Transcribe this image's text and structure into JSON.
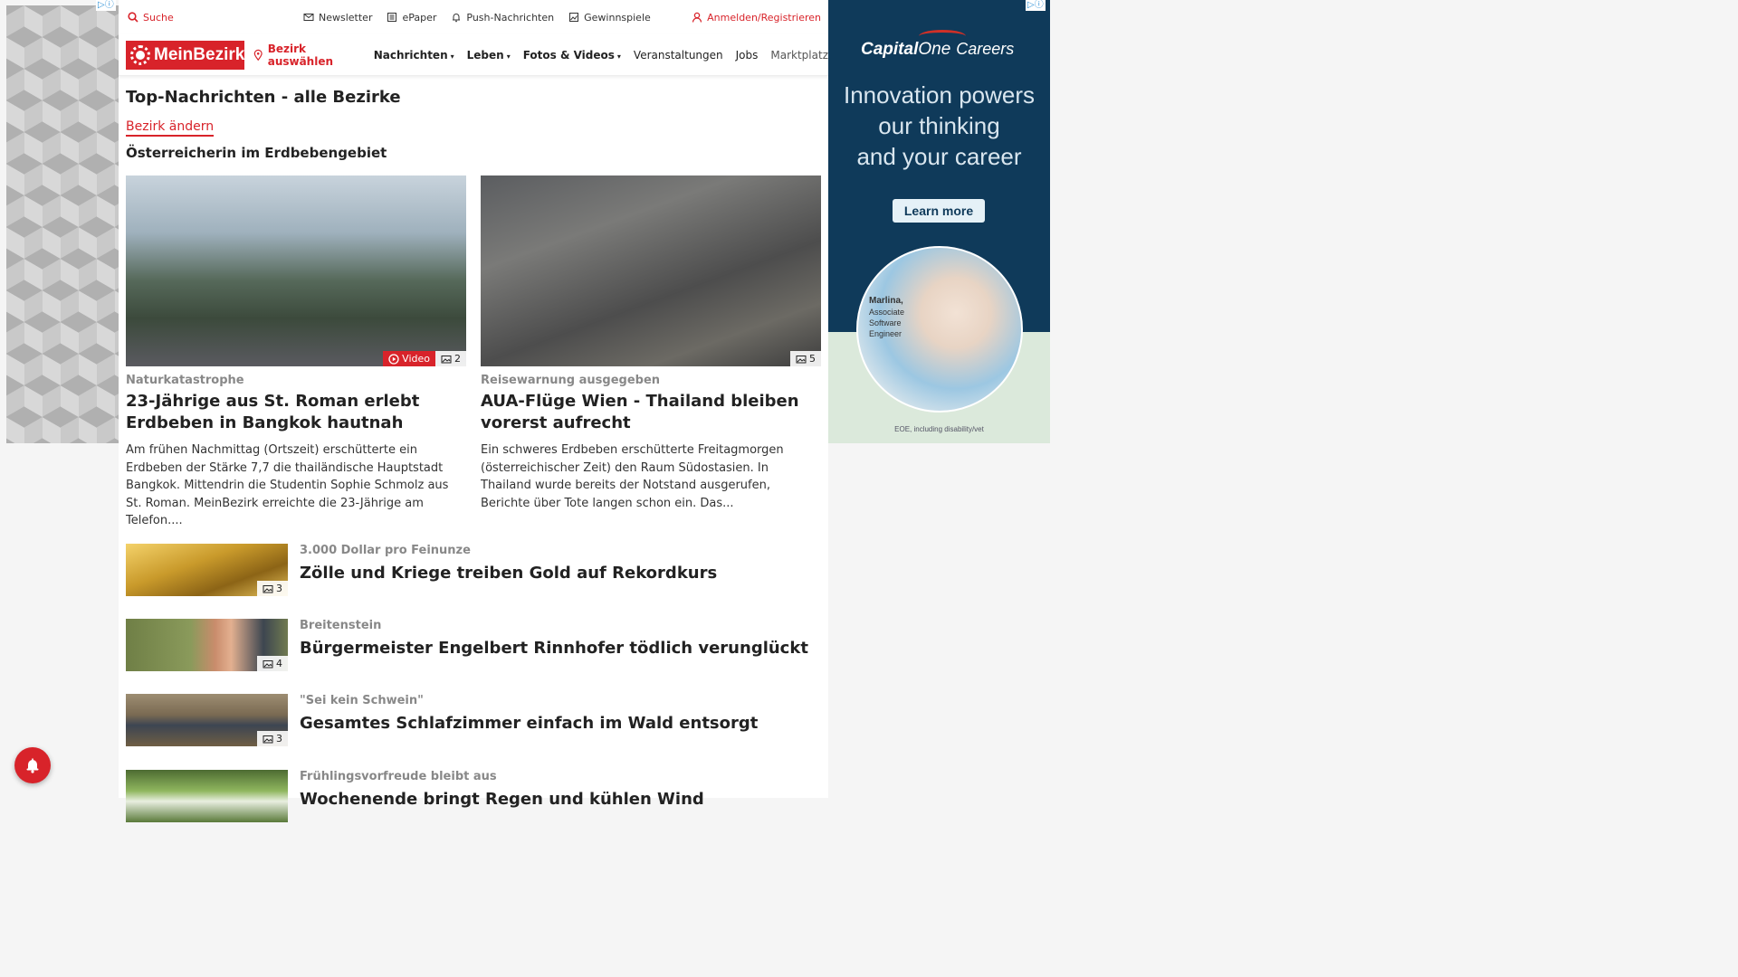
{
  "left_ad": {
    "badge": "▷ⓘ"
  },
  "topbar": {
    "search": "Suche",
    "links": [
      "Newsletter",
      "ePaper",
      "Push-Nachrichten",
      "Gewinnspiele"
    ],
    "login": "Anmelden/Registrieren"
  },
  "navbar": {
    "logo": "MeinBezirk",
    "bezirk": "Bezirk auswählen",
    "items": [
      "Nachrichten",
      "Leben",
      "Fotos & Videos",
      "Veranstaltungen",
      "Jobs",
      "Marktplatz"
    ]
  },
  "page": {
    "title": "Top-Nachrichten - alle Bezirke",
    "change_link": "Bezirk ändern",
    "section_title": "Österreicherin im Erdbebengebiet"
  },
  "cards": [
    {
      "kicker": "Naturkatastrophe",
      "headline": "23-Jährige aus St. Roman erlebt Erdbeben in Bangkok hautnah",
      "teaser": "Am frühen Nachmittag (Ortszeit) erschütterte ein Erdbeben der Stärke 7,7 die thailändische Hauptstadt Bangkok. Mittendrin die Studentin Sophie Schmolz aus St. Roman. MeinBezirk erreichte die 23-Jährige am Telefon....",
      "video_label": "Video",
      "photo_count": "2"
    },
    {
      "kicker": "Reisewarnung ausgegeben",
      "headline": "AUA-Flüge Wien - Thailand bleiben vorerst aufrecht",
      "teaser": "Ein schweres Erdbeben erschütterte Freitagmorgen (österreichischer Zeit) den Raum Südostasien. In Thailand wurde bereits der Notstand ausgerufen, Berichte über Tote langen schon ein. Das...",
      "photo_count": "5"
    }
  ],
  "rows": [
    {
      "kicker": "3.000 Dollar pro Feinunze",
      "headline": "Zölle und Kriege treiben Gold auf Rekordkurs",
      "photo_count": "3"
    },
    {
      "kicker": "Breitenstein",
      "headline": "Bürgermeister Engelbert Rinnhofer tödlich verunglückt",
      "photo_count": "4"
    },
    {
      "kicker": "\"Sei kein Schwein\"",
      "headline": "Gesamtes Schlafzimmer einfach im Wald entsorgt",
      "photo_count": "3"
    },
    {
      "kicker": "Frühlingsvorfreude bleibt aus",
      "headline": "Wochenende bringt Regen und kühlen Wind",
      "photo_count": ""
    }
  ],
  "right_ad": {
    "badge": "▷ⓘ",
    "brand_bold": "Capital",
    "brand_italic": "One",
    "brand_suffix": "Careers",
    "tagline_1": "Innovation powers",
    "tagline_2": "our thinking",
    "tagline_3": "and your career",
    "cta": "Learn more",
    "person_name": "Marlina,",
    "person_role_1": "Associate",
    "person_role_2": "Software",
    "person_role_3": "Engineer",
    "footer": "EOE, including disability/vet",
    "colors": {
      "navy": "#0f3a5a",
      "red": "#d03027",
      "mint": "#dbe9db"
    }
  },
  "colors": {
    "brand_red": "#d8232a",
    "kicker_gray": "#888888"
  }
}
